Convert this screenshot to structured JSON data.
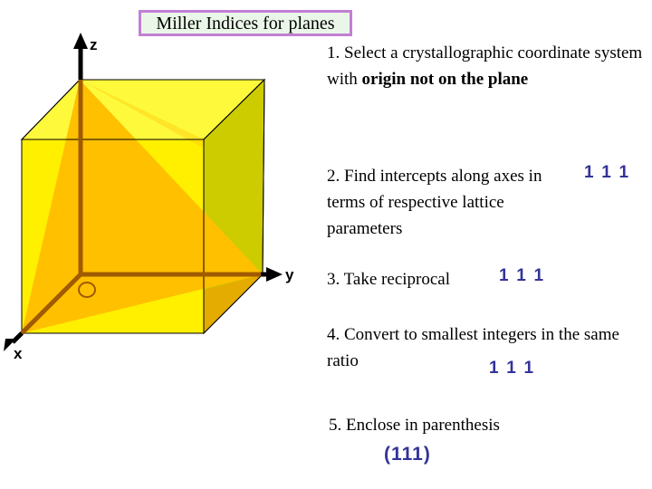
{
  "slide": {
    "title": "Miller Indices for planes",
    "title_border_color": "#c27fd4",
    "title_background_color": "#eaf7e8"
  },
  "diagram": {
    "name": "crystal-unit-cell-with-111-plane",
    "axes": [
      {
        "id": "z",
        "label": "z"
      },
      {
        "id": "y",
        "label": "y"
      },
      {
        "id": "x",
        "label": "x"
      }
    ],
    "origin_label": "O",
    "colors": {
      "top_face": "#fff93c",
      "front_face": "#fff000",
      "right_face": "#cccc00",
      "plane_111": "#ffc000",
      "plane_111_shaded": "#f0a800",
      "axis_line": "#a05a00",
      "edge": "#000000"
    }
  },
  "steps": [
    {
      "id": "step-1",
      "text_before": "1. Select a crystallographic coordinate system with ",
      "text_bold": "origin not on the plane",
      "values": ""
    },
    {
      "id": "step-2",
      "text": "2. Find intercepts along axes in terms of respective lattice parameters",
      "values": "1  1  1"
    },
    {
      "id": "step-3",
      "text": "3. Take reciprocal",
      "values": "1  1  1"
    },
    {
      "id": "step-4",
      "text": "4. Convert to smallest integers in the same ratio",
      "values": "1  1  1"
    },
    {
      "id": "step-5",
      "text": "5.  Enclose in parenthesis",
      "values": "(111)"
    }
  ],
  "answer": "(111)",
  "accent_color": "#333399"
}
